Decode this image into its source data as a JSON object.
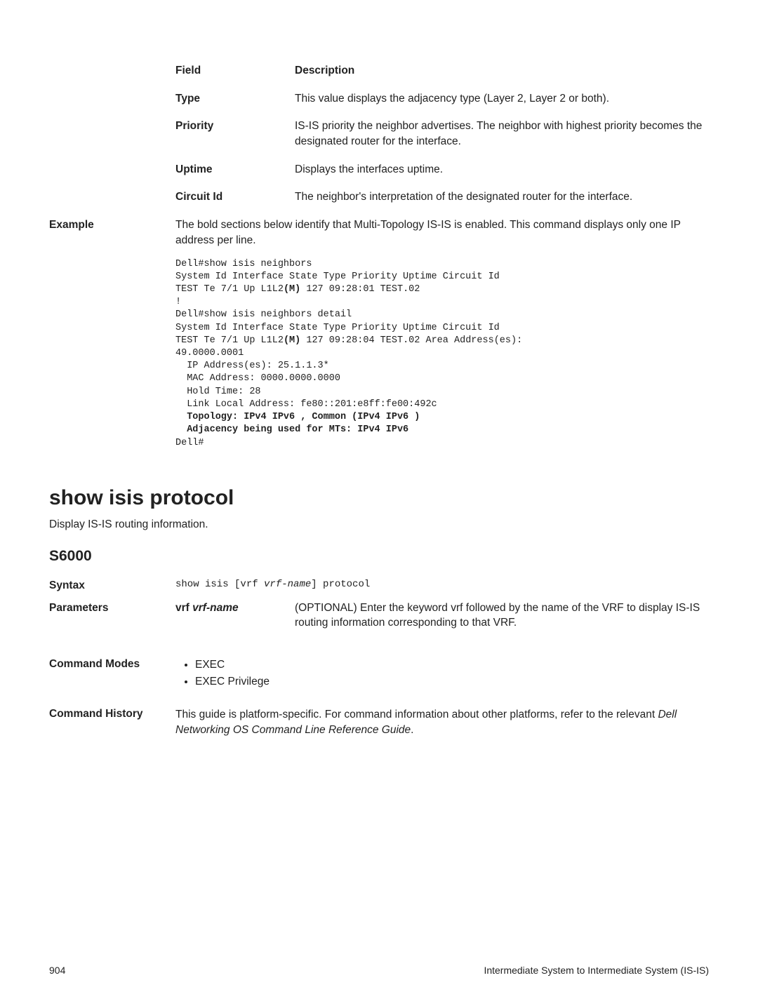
{
  "fieldsHeader": {
    "col1": "Field",
    "col2": "Description"
  },
  "fields": [
    {
      "name": "Type",
      "desc": "This value displays the adjacency type (Layer 2, Layer 2 or both)."
    },
    {
      "name": "Priority",
      "desc": "IS-IS priority the neighbor advertises. The neighbor with highest priority becomes the designated router for the interface."
    },
    {
      "name": "Uptime",
      "desc": "Displays the interfaces uptime."
    },
    {
      "name": "Circuit Id",
      "desc": "The neighbor's interpretation of the designated router for the interface."
    }
  ],
  "exampleLabel": "Example",
  "exampleIntro": "The bold sections below identify that Multi-Topology IS-IS is enabled. This command displays only one IP address per line.",
  "pre": {
    "l1": "Dell#show isis neighbors",
    "l2": "System Id Interface State Type Priority Uptime Circuit Id",
    "l3a": "TEST Te 7/1 Up L1L2",
    "l3b": "(M)",
    "l3c": " 127 09:28:01 TEST.02",
    "l4": "!",
    "l5": "Dell#show isis neighbors detail",
    "l6": "System Id Interface State Type Priority Uptime Circuit Id",
    "l7a": "TEST Te 7/1 Up L1L2",
    "l7b": "(M)",
    "l7c": " 127 09:28:04 TEST.02 Area Address(es):",
    "l8": "49.0000.0001",
    "l9": "  IP Address(es): 25.1.1.3*",
    "l10": "  MAC Address: 0000.0000.0000",
    "l11": "  Hold Time: 28",
    "l12": "  Link Local Address: fe80::201:e8ff:fe00:492c",
    "l13": "  Topology: IPv4 IPv6 , Common (IPv4 IPv6 )",
    "l14": "  Adjacency being used for MTs: IPv4 IPv6",
    "l15": "Dell#"
  },
  "cmdTitle": "show isis protocol",
  "cmdSubtitle": "Display IS-IS routing information.",
  "model": "S6000",
  "syntaxLabel": "Syntax",
  "syntax": {
    "p1": "show isis [vrf ",
    "p2": "vrf-name",
    "p3": "] protocol"
  },
  "paramsLabel": "Parameters",
  "param": {
    "prefix": "vrf ",
    "var": "vrf-name",
    "desc": "(OPTIONAL) Enter the keyword vrf followed by the name of the VRF to display IS-IS routing information corresponding to that VRF."
  },
  "cmdModesLabel": "Command Modes",
  "modes": [
    "EXEC",
    "EXEC Privilege"
  ],
  "cmdHistoryLabel": "Command History",
  "cmdHistory": {
    "p1": "This guide is platform-specific. For command information about other platforms, refer to the relevant ",
    "p2": "Dell Networking OS Command Line Reference Guide",
    "p3": "."
  },
  "footer": {
    "page": "904",
    "title": "Intermediate System to Intermediate System (IS-IS)"
  }
}
